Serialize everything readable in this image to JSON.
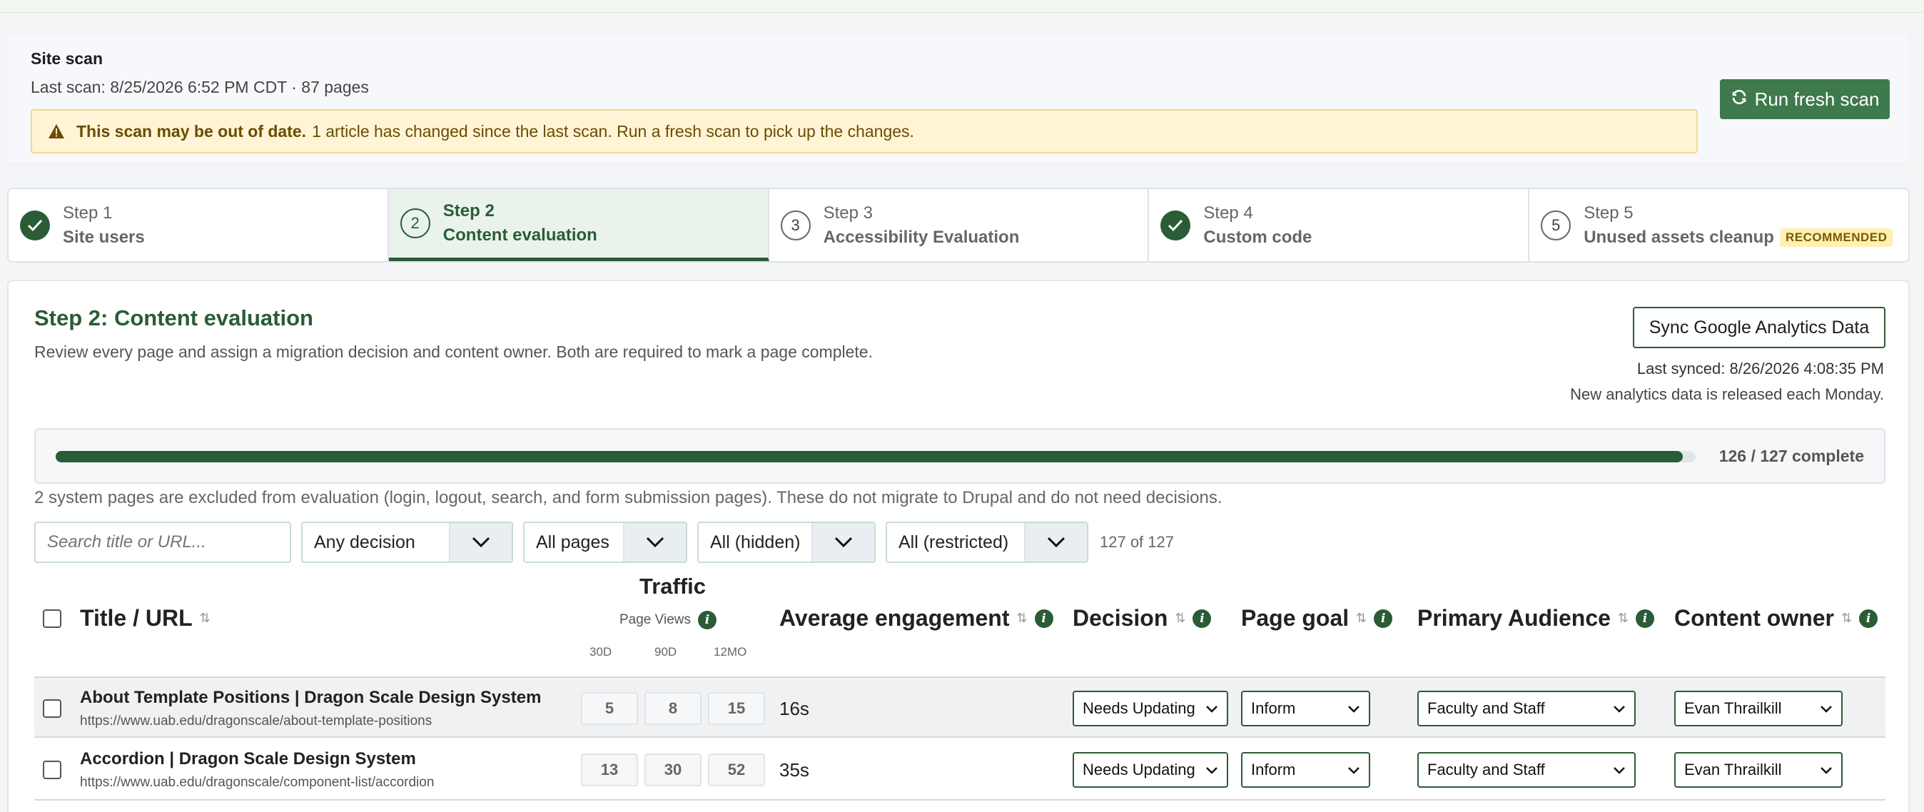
{
  "scan": {
    "title": "Site scan",
    "subtitle": "Last scan: 8/25/2026 6:52 PM CDT · 87 pages",
    "warning_bold": "This scan may be out of date.",
    "warning_text": "1 article has changed since the last scan. Run a fresh scan to pick up the changes.",
    "fresh_button": "Run fresh scan"
  },
  "steps": [
    {
      "label": "Step 1",
      "name": "Site users",
      "state": "done"
    },
    {
      "label": "Step 2",
      "name": "Content evaluation",
      "state": "active",
      "number": "2"
    },
    {
      "label": "Step 3",
      "name": "Accessibility Evaluation",
      "state": "todo",
      "number": "3"
    },
    {
      "label": "Step 4",
      "name": "Custom code",
      "state": "done"
    },
    {
      "label": "Step 5",
      "name": "Unused assets cleanup",
      "state": "todo",
      "number": "5",
      "badge": "RECOMMENDED"
    }
  ],
  "content": {
    "title": "Step 2: Content evaluation",
    "description": "Review every page and assign a migration decision and content owner. Both are required to mark a page complete.",
    "ga_button": "Sync Google Analytics Data",
    "last_synced": "Last synced: 8/26/2026 4:08:35 PM",
    "analytics_note": "New analytics data is released each Monday.",
    "progress_label": "126 / 127 complete",
    "progress_fraction": 0.992,
    "excluded_note": "2 system pages are excluded from evaluation (login, logout, search, and form submission pages). These do not migrate to Drupal and do not need decisions."
  },
  "filters": {
    "search_placeholder": "Search title or URL...",
    "decision": "Any decision",
    "pages": "All pages",
    "hidden": "All (hidden)",
    "restricted": "All (restricted)",
    "count": "127 of 127"
  },
  "table": {
    "headers": {
      "title": "Title / URL",
      "traffic": "Traffic",
      "page_views": "Page Views",
      "d30": "30D",
      "d90": "90D",
      "m12": "12MO",
      "engagement": "Average engagement",
      "decision": "Decision",
      "goal": "Page goal",
      "audience": "Primary Audience",
      "owner": "Content owner"
    },
    "rows": [
      {
        "title": "About Template Positions | Dragon Scale Design System",
        "url": "https://www.uab.edu/dragonscale/about-template-positions",
        "d30": "5",
        "d90": "8",
        "m12": "15",
        "engagement": "16s",
        "decision": "Needs Updating",
        "goal": "Inform",
        "audience": "Faculty and Staff",
        "owner": "Evan Thrailkill"
      },
      {
        "title": "Accordion | Dragon Scale Design System",
        "url": "https://www.uab.edu/dragonscale/component-list/accordion",
        "d30": "13",
        "d90": "30",
        "m12": "52",
        "engagement": "35s",
        "decision": "Needs Updating",
        "goal": "Inform",
        "audience": "Faculty and Staff",
        "owner": "Evan Thrailkill"
      }
    ]
  }
}
